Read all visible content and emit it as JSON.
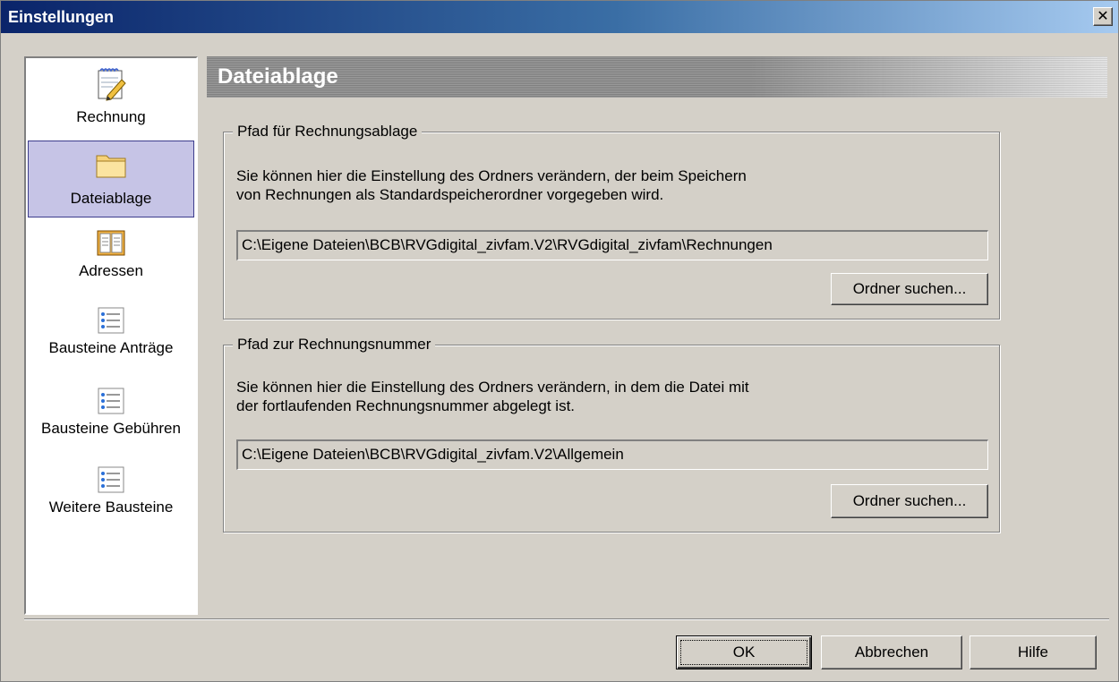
{
  "window": {
    "title": "Einstellungen",
    "close_glyph": "✕"
  },
  "sidebar": {
    "items": [
      {
        "label": "Rechnung",
        "icon": "notepad-pencil-icon",
        "selected": false
      },
      {
        "label": "Dateiablage",
        "icon": "folder-icon",
        "selected": true
      },
      {
        "label": "Adressen",
        "icon": "address-book-icon",
        "selected": false
      },
      {
        "label": "Bausteine Anträge",
        "icon": "text-blocks-icon",
        "selected": false
      },
      {
        "label": "Bausteine Gebühren",
        "icon": "text-blocks-icon",
        "selected": false
      },
      {
        "label": "Weitere Bausteine",
        "icon": "text-blocks-icon",
        "selected": false
      }
    ]
  },
  "page": {
    "title": "Dateiablage"
  },
  "group_invoice": {
    "legend": "Pfad für Rechnungsablage",
    "desc_line1": "Sie können hier die Einstellung des Ordners verändern, der beim Speichern",
    "desc_line2": "von Rechnungen als Standardspeicherordner vorgegeben wird.",
    "path": "C:\\Eigene Dateien\\BCB\\RVGdigital_zivfam.V2\\RVGdigital_zivfam\\Rechnungen",
    "button": "Ordner suchen..."
  },
  "group_number": {
    "legend": "Pfad zur Rechnungsnummer",
    "desc_line1": "Sie können hier die Einstellung des Ordners verändern, in dem die Datei mit",
    "desc_line2": "der fortlaufenden Rechnungsnummer abgelegt ist.",
    "path": "C:\\Eigene Dateien\\BCB\\RVGdigital_zivfam.V2\\Allgemein",
    "button": "Ordner suchen..."
  },
  "footer": {
    "ok": "OK",
    "cancel": "Abbrechen",
    "help": "Hilfe"
  }
}
